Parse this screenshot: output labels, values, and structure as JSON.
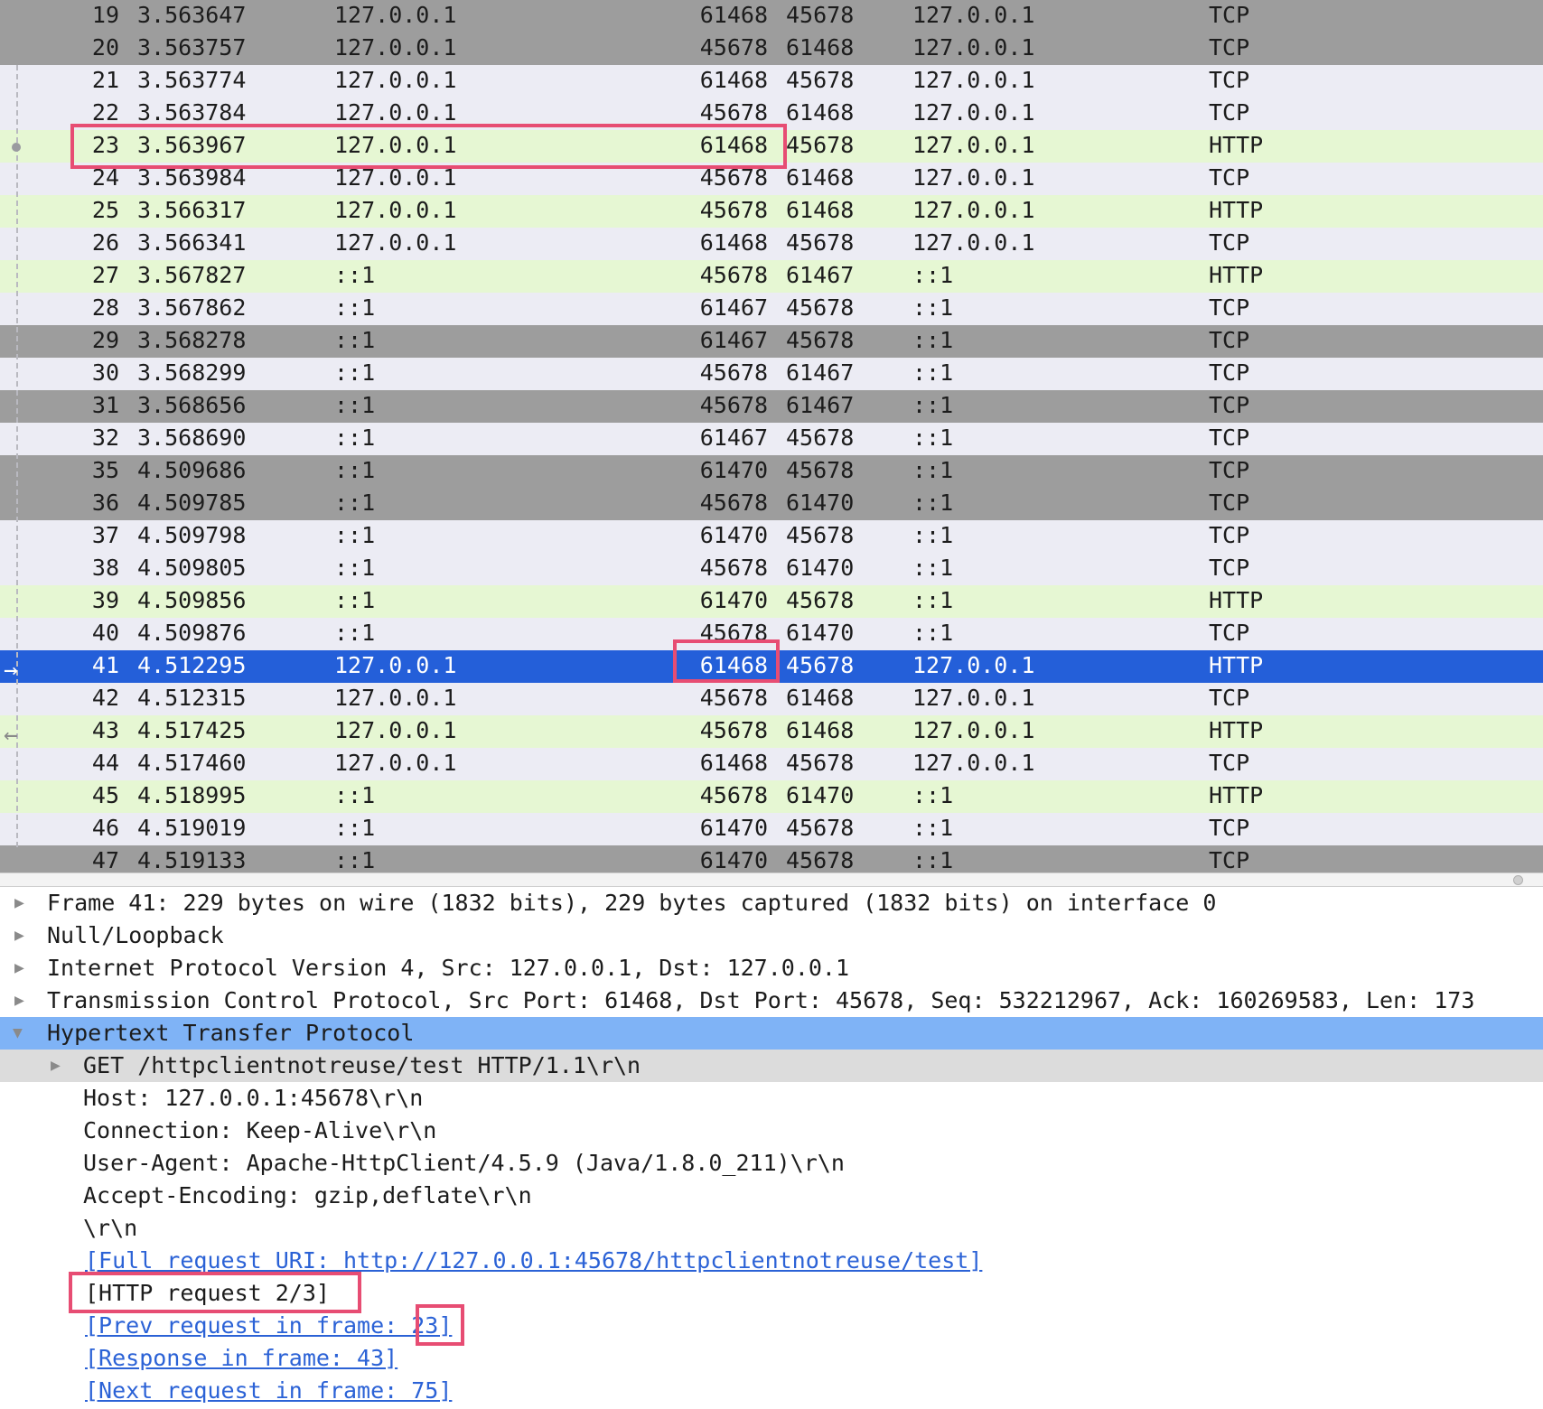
{
  "packets": [
    {
      "no": "19",
      "time": "3.563647",
      "src": "127.0.0.1",
      "sport": "61468",
      "dport": "45678",
      "dst": "127.0.0.1",
      "proto": "TCP"
    },
    {
      "no": "20",
      "time": "3.563757",
      "src": "127.0.0.1",
      "sport": "45678",
      "dport": "61468",
      "dst": "127.0.0.1",
      "proto": "TCP"
    },
    {
      "no": "21",
      "time": "3.563774",
      "src": "127.0.0.1",
      "sport": "61468",
      "dport": "45678",
      "dst": "127.0.0.1",
      "proto": "TCP"
    },
    {
      "no": "22",
      "time": "3.563784",
      "src": "127.0.0.1",
      "sport": "45678",
      "dport": "61468",
      "dst": "127.0.0.1",
      "proto": "TCP"
    },
    {
      "no": "23",
      "time": "3.563967",
      "src": "127.0.0.1",
      "sport": "61468",
      "dport": "45678",
      "dst": "127.0.0.1",
      "proto": "HTTP"
    },
    {
      "no": "24",
      "time": "3.563984",
      "src": "127.0.0.1",
      "sport": "45678",
      "dport": "61468",
      "dst": "127.0.0.1",
      "proto": "TCP"
    },
    {
      "no": "25",
      "time": "3.566317",
      "src": "127.0.0.1",
      "sport": "45678",
      "dport": "61468",
      "dst": "127.0.0.1",
      "proto": "HTTP"
    },
    {
      "no": "26",
      "time": "3.566341",
      "src": "127.0.0.1",
      "sport": "61468",
      "dport": "45678",
      "dst": "127.0.0.1",
      "proto": "TCP"
    },
    {
      "no": "27",
      "time": "3.567827",
      "src": "::1",
      "sport": "45678",
      "dport": "61467",
      "dst": "::1",
      "proto": "HTTP"
    },
    {
      "no": "28",
      "time": "3.567862",
      "src": "::1",
      "sport": "61467",
      "dport": "45678",
      "dst": "::1",
      "proto": "TCP"
    },
    {
      "no": "29",
      "time": "3.568278",
      "src": "::1",
      "sport": "61467",
      "dport": "45678",
      "dst": "::1",
      "proto": "TCP"
    },
    {
      "no": "30",
      "time": "3.568299",
      "src": "::1",
      "sport": "45678",
      "dport": "61467",
      "dst": "::1",
      "proto": "TCP"
    },
    {
      "no": "31",
      "time": "3.568656",
      "src": "::1",
      "sport": "45678",
      "dport": "61467",
      "dst": "::1",
      "proto": "TCP"
    },
    {
      "no": "32",
      "time": "3.568690",
      "src": "::1",
      "sport": "61467",
      "dport": "45678",
      "dst": "::1",
      "proto": "TCP"
    },
    {
      "no": "35",
      "time": "4.509686",
      "src": "::1",
      "sport": "61470",
      "dport": "45678",
      "dst": "::1",
      "proto": "TCP"
    },
    {
      "no": "36",
      "time": "4.509785",
      "src": "::1",
      "sport": "45678",
      "dport": "61470",
      "dst": "::1",
      "proto": "TCP"
    },
    {
      "no": "37",
      "time": "4.509798",
      "src": "::1",
      "sport": "61470",
      "dport": "45678",
      "dst": "::1",
      "proto": "TCP"
    },
    {
      "no": "38",
      "time": "4.509805",
      "src": "::1",
      "sport": "45678",
      "dport": "61470",
      "dst": "::1",
      "proto": "TCP"
    },
    {
      "no": "39",
      "time": "4.509856",
      "src": "::1",
      "sport": "61470",
      "dport": "45678",
      "dst": "::1",
      "proto": "HTTP"
    },
    {
      "no": "40",
      "time": "4.509876",
      "src": "::1",
      "sport": "45678",
      "dport": "61470",
      "dst": "::1",
      "proto": "TCP"
    },
    {
      "no": "41",
      "time": "4.512295",
      "src": "127.0.0.1",
      "sport": "61468",
      "dport": "45678",
      "dst": "127.0.0.1",
      "proto": "HTTP"
    },
    {
      "no": "42",
      "time": "4.512315",
      "src": "127.0.0.1",
      "sport": "45678",
      "dport": "61468",
      "dst": "127.0.0.1",
      "proto": "TCP"
    },
    {
      "no": "43",
      "time": "4.517425",
      "src": "127.0.0.1",
      "sport": "45678",
      "dport": "61468",
      "dst": "127.0.0.1",
      "proto": "HTTP"
    },
    {
      "no": "44",
      "time": "4.517460",
      "src": "127.0.0.1",
      "sport": "61468",
      "dport": "45678",
      "dst": "127.0.0.1",
      "proto": "TCP"
    },
    {
      "no": "45",
      "time": "4.518995",
      "src": "::1",
      "sport": "45678",
      "dport": "61470",
      "dst": "::1",
      "proto": "HTTP"
    },
    {
      "no": "46",
      "time": "4.519019",
      "src": "::1",
      "sport": "61470",
      "dport": "45678",
      "dst": "::1",
      "proto": "TCP"
    },
    {
      "no": "47",
      "time": "4.519133",
      "src": "::1",
      "sport": "61470",
      "dport": "45678",
      "dst": "::1",
      "proto": "TCP"
    }
  ],
  "details": {
    "frame": "Frame 41: 229 bytes on wire (1832 bits), 229 bytes captured (1832 bits) on interface 0",
    "null_loopback": "Null/Loopback",
    "ipv4": "Internet Protocol Version 4, Src: 127.0.0.1, Dst: 127.0.0.1",
    "tcp": "Transmission Control Protocol, Src Port: 61468, Dst Port: 45678, Seq: 532212967, Ack: 160269583, Len: 173",
    "http": "Hypertext Transfer Protocol",
    "http_lines": {
      "get": "GET /httpclientnotreuse/test HTTP/1.1\\r\\n",
      "host": "Host: 127.0.0.1:45678\\r\\n",
      "connection": "Connection: Keep-Alive\\r\\n",
      "user_agent": "User-Agent: Apache-HttpClient/4.5.9 (Java/1.8.0_211)\\r\\n",
      "accept_encoding": "Accept-Encoding: gzip,deflate\\r\\n",
      "crlf": "\\r\\n",
      "full_uri": "[Full request URI: http://127.0.0.1:45678/httpclientnotreuse/test]",
      "request_num": "[HTTP request 2/3]",
      "prev_request": "[Prev request in frame: 23]",
      "response": "[Response in frame: 43]",
      "next_request": "[Next request in frame: 75]"
    }
  },
  "colors": {
    "row_light": "#ececf4",
    "row_http": "#e6f7d3",
    "row_gray": "#9d9d9d",
    "row_selected": "#245fd9",
    "detail_selected": "#7fb3f6",
    "highlight_box": "#e74d73",
    "link": "#2b62d6"
  },
  "icons": {
    "expand": "triangle-right-icon",
    "collapse": "triangle-down-icon",
    "request_arrow": "arrow-right-icon",
    "response_arrow": "arrow-left-icon"
  }
}
